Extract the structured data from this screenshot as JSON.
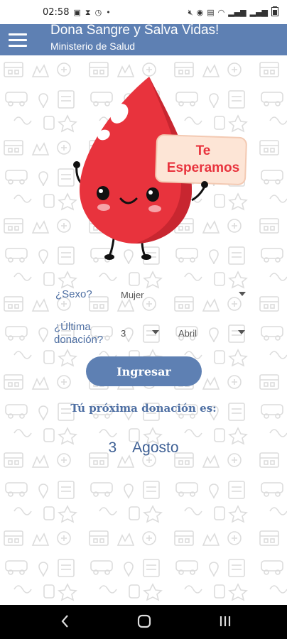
{
  "status_bar": {
    "time": "02:58",
    "left_icons": [
      "gallery-icon",
      "hourglass-icon",
      "timer-icon",
      "dot-icon"
    ],
    "right_icons": [
      "mute-icon",
      "hotspot-icon",
      "nfc-icon",
      "wifi-icon",
      "signal-icon",
      "signal-icon",
      "battery-icon"
    ]
  },
  "app_bar": {
    "title": "Dona Sangre y Salva Vidas!",
    "subtitle": "Ministerio de Salud"
  },
  "mascot": {
    "sign_line1": "Te",
    "sign_line2": "Esperamos"
  },
  "form": {
    "sexo_label": "¿Sexo?",
    "sexo_value": "Mujer",
    "ultima_label_line1": "¿Última",
    "ultima_label_line2": "donación?",
    "day_value": "3",
    "month_value": "Abril"
  },
  "button": {
    "label": "Ingresar"
  },
  "result": {
    "title": "Tú próxima donación es:",
    "day": "3",
    "month": "Agosto"
  },
  "colors": {
    "primary": "#5e80b3",
    "drop": "#e8333d",
    "sign_bg": "#fde5d6"
  }
}
